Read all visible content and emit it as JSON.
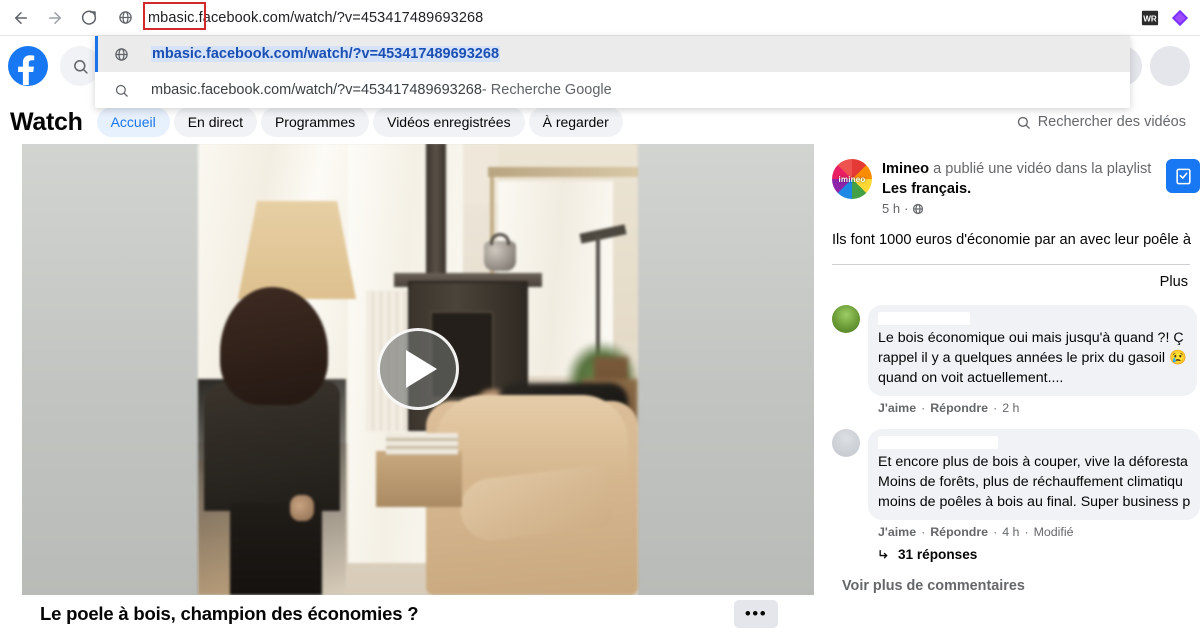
{
  "browser": {
    "back_icon": "back-arrow",
    "forward_icon": "forward-arrow",
    "reload_icon": "reload",
    "url": "mbasic.facebook.com/watch/?v=453417489693268",
    "url_highlight_part": "mbasic.",
    "site_icon": "globe-icon",
    "extensions": [
      "wr-extension",
      "diamond-extension"
    ],
    "suggestions": [
      {
        "icon": "globe-icon",
        "text": "mbasic.facebook.com/watch/?v=453417489693268",
        "suffix": "",
        "selected": true,
        "type": "url"
      },
      {
        "icon": "search-icon",
        "text": "mbasic.facebook.com/watch/?v=453417489693268",
        "suffix": " - Recherche Google",
        "selected": false,
        "type": "search"
      }
    ]
  },
  "fb_header": {
    "logo": "facebook-logo",
    "search_icon": "search-icon",
    "grid_icon": "apps-grid-icon"
  },
  "watch": {
    "title": "Watch",
    "tabs": [
      {
        "label": "Accueil",
        "active": true
      },
      {
        "label": "En direct",
        "active": false
      },
      {
        "label": "Programmes",
        "active": false
      },
      {
        "label": "Vidéos enregistrées",
        "active": false
      },
      {
        "label": "À regarder",
        "active": false
      }
    ],
    "search_placeholder": "Rechercher des vidéos",
    "search_icon": "search-icon"
  },
  "video": {
    "title": "Le poele à bois, champion des économies ?",
    "play_icon": "play-button",
    "more_label": "•••",
    "more_icon": "ellipsis-icon"
  },
  "post": {
    "avatar_label": "imineo",
    "author": "Imineo",
    "action_text": " a publié une vidéo dans la playlist ",
    "playlist": "Les français.",
    "time": "5 h",
    "privacy_icon": "globe-icon",
    "separator": "·",
    "body": "Ils font 1000 euros d'économie par an avec leur poêle à",
    "more_label": "Plus",
    "save_icon": "save-playlist-icon"
  },
  "comments": [
    {
      "avatar": "green-avatar",
      "name_hidden": true,
      "lines": [
        "Le bois économique oui mais jusqu'à quand ?! Ç",
        "rappel il y a quelques années le prix du gasoil 😢",
        "quand on voit actuellement...."
      ],
      "like_label": "J'aime",
      "reply_label": "Répondre",
      "time": "2 h",
      "edited": "",
      "replies": ""
    },
    {
      "avatar": "gray-avatar",
      "name_hidden": true,
      "lines": [
        "Et encore plus de bois à couper, vive la déforesta",
        "Moins de forêts, plus de réchauffement climatiqu",
        "moins de poêles à bois au final. Super business p"
      ],
      "like_label": "J'aime",
      "reply_label": "Répondre",
      "time": "4 h",
      "edited": "Modifié",
      "replies": "31 réponses",
      "replies_icon": "reply-arrow-icon"
    }
  ],
  "see_more_comments": "Voir plus de commentaires",
  "colors": {
    "fb_blue": "#1877f2",
    "highlight_red": "#d0282b",
    "omni_selected": "#1a73e8",
    "bubble_gray": "#f0f2f5"
  }
}
